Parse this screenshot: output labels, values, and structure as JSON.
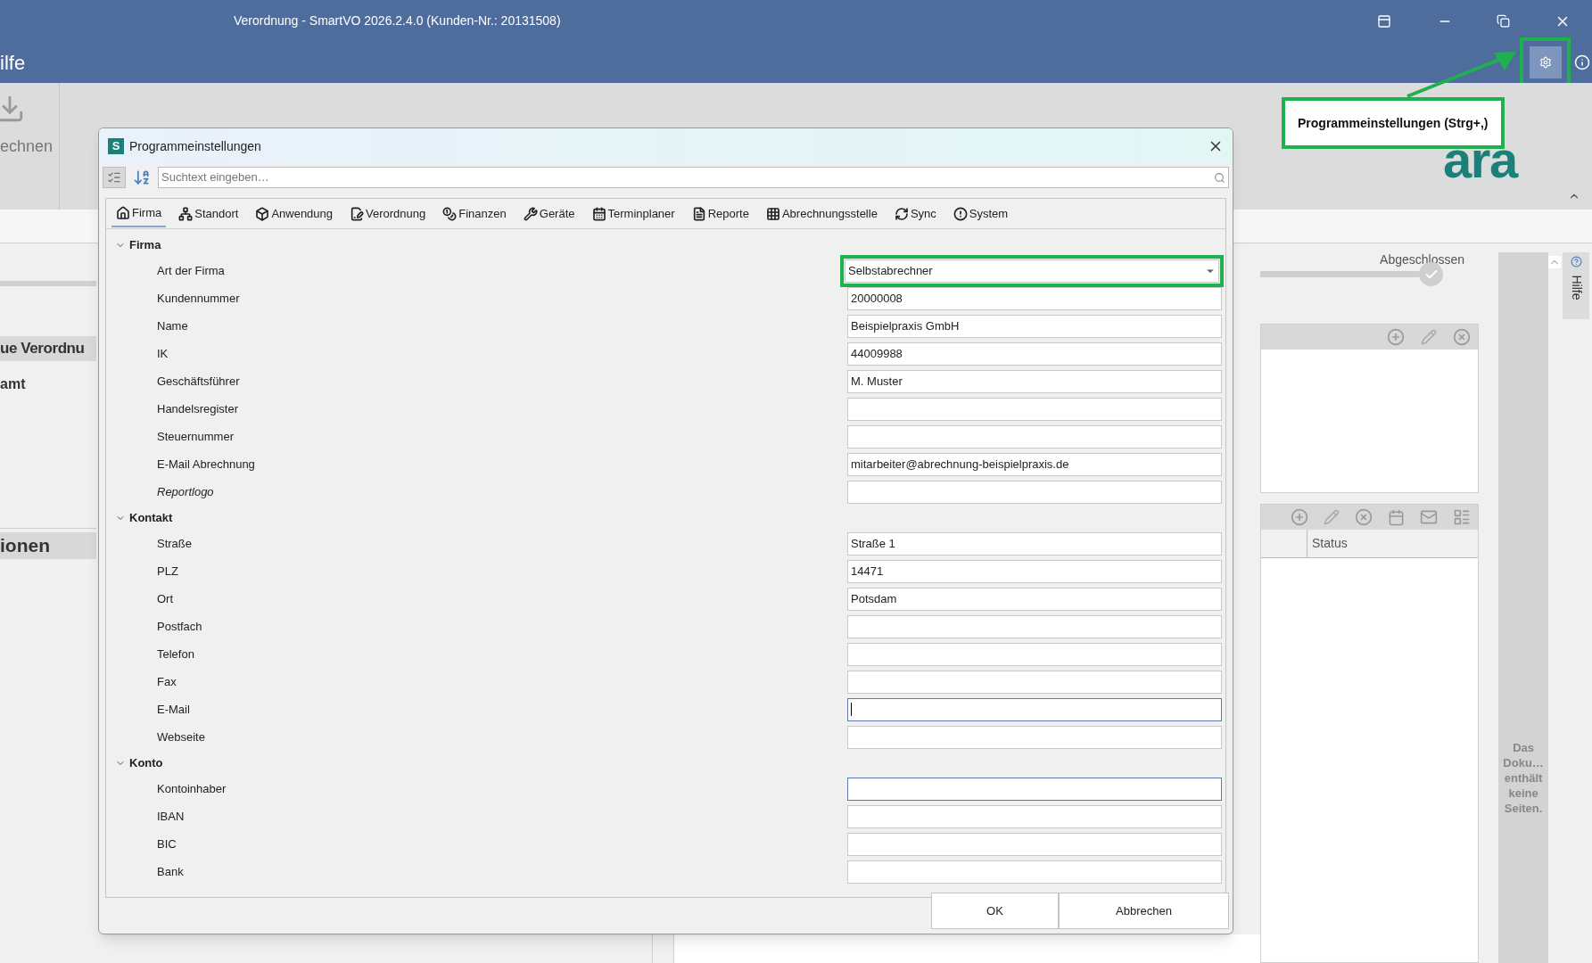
{
  "window": {
    "title": "Verordnung - SmartVO 2026.2.4.0 (Kunden-Nr.: 20131508)"
  },
  "menu": {
    "item": "ilfe"
  },
  "ribbon": {
    "button": "echnen",
    "logo": "ara"
  },
  "settings_button": {
    "highlighted": true
  },
  "tooltip": {
    "text": "Programmeinstellungen (Strg+,)"
  },
  "left_panel": {
    "heading": "ue Verordnu",
    "label": "amt",
    "section": "ionen"
  },
  "progress": {
    "label": "Abgeschlossen"
  },
  "table": {
    "columns": [
      "Status"
    ]
  },
  "preview": {
    "message": "Das Doku… enthält keine Seiten."
  },
  "help_tab": {
    "label": "Hilfe"
  },
  "dialog": {
    "icon_letter": "S",
    "title": "Programmeinstellungen",
    "search": {
      "placeholder": "Suchtext eingeben…"
    },
    "tabs": [
      {
        "label": "Firma",
        "selected": true
      },
      {
        "label": "Standort",
        "selected": false
      },
      {
        "label": "Anwendung",
        "selected": false
      },
      {
        "label": "Verordnung",
        "selected": false
      },
      {
        "label": "Finanzen",
        "selected": false
      },
      {
        "label": "Geräte",
        "selected": false
      },
      {
        "label": "Terminplaner",
        "selected": false
      },
      {
        "label": "Reporte",
        "selected": false
      },
      {
        "label": "Abrechnungsstelle",
        "selected": false
      },
      {
        "label": "Sync",
        "selected": false
      },
      {
        "label": "System",
        "selected": false
      }
    ],
    "sections": [
      {
        "title": "Firma",
        "expanded": true,
        "rows": [
          {
            "label": "Art der Firma",
            "kind": "dropdown",
            "value": "Selbstabrechner",
            "italic": false,
            "active": false,
            "caret": false,
            "highlighted": true
          },
          {
            "label": "Kundennummer",
            "kind": "text",
            "value": "20000008",
            "italic": false,
            "active": false,
            "caret": false,
            "highlighted": false
          },
          {
            "label": "Name",
            "kind": "text",
            "value": "Beispielpraxis GmbH",
            "italic": false,
            "active": false,
            "caret": false,
            "highlighted": false
          },
          {
            "label": "IK",
            "kind": "text",
            "value": "44009988",
            "italic": false,
            "active": false,
            "caret": false,
            "highlighted": false
          },
          {
            "label": "Geschäftsführer",
            "kind": "text",
            "value": "M. Muster",
            "italic": false,
            "active": false,
            "caret": false,
            "highlighted": false
          },
          {
            "label": "Handelsregister",
            "kind": "text",
            "italic": false,
            "active": false,
            "caret": false,
            "highlighted": false
          },
          {
            "label": "Steuernummer",
            "kind": "text",
            "italic": false,
            "active": false,
            "caret": false,
            "highlighted": false
          },
          {
            "label": "E-Mail Abrechnung",
            "kind": "text",
            "value": "mitarbeiter@abrechnung-beispielpraxis.de",
            "italic": false,
            "active": false,
            "caret": false,
            "highlighted": false
          },
          {
            "label": "Reportlogo",
            "kind": "text",
            "italic": true,
            "active": false,
            "caret": false,
            "highlighted": false
          }
        ]
      },
      {
        "title": "Kontakt",
        "expanded": true,
        "rows": [
          {
            "label": "Straße",
            "kind": "text",
            "value": "Straße 1",
            "italic": false,
            "active": false,
            "caret": false,
            "highlighted": false
          },
          {
            "label": "PLZ",
            "kind": "text",
            "value": "14471",
            "italic": false,
            "active": false,
            "caret": false,
            "highlighted": false
          },
          {
            "label": "Ort",
            "kind": "text",
            "value": "Potsdam",
            "italic": false,
            "active": false,
            "caret": false,
            "highlighted": false
          },
          {
            "label": "Postfach",
            "kind": "text",
            "italic": false,
            "active": false,
            "caret": false,
            "highlighted": false
          },
          {
            "label": "Telefon",
            "kind": "text",
            "italic": false,
            "active": false,
            "caret": false,
            "highlighted": false
          },
          {
            "label": "Fax",
            "kind": "text",
            "italic": false,
            "active": false,
            "caret": false,
            "highlighted": false
          },
          {
            "label": "E-Mail",
            "kind": "text",
            "italic": false,
            "active": true,
            "caret": true,
            "highlighted": false
          },
          {
            "label": "Webseite",
            "kind": "text",
            "italic": false,
            "active": false,
            "caret": false,
            "highlighted": false
          }
        ]
      },
      {
        "title": "Konto",
        "expanded": true,
        "rows": [
          {
            "label": "Kontoinhaber",
            "kind": "text",
            "italic": false,
            "active": true,
            "caret": false,
            "highlighted": false
          },
          {
            "label": "IBAN",
            "kind": "text",
            "italic": false,
            "active": false,
            "caret": false,
            "highlighted": false
          },
          {
            "label": "BIC",
            "kind": "text",
            "italic": false,
            "active": false,
            "caret": false,
            "highlighted": false
          },
          {
            "label": "Bank",
            "kind": "text",
            "italic": false,
            "active": false,
            "caret": false,
            "highlighted": false
          }
        ]
      }
    ],
    "buttons": [
      "OK",
      "Abbrechen"
    ]
  }
}
